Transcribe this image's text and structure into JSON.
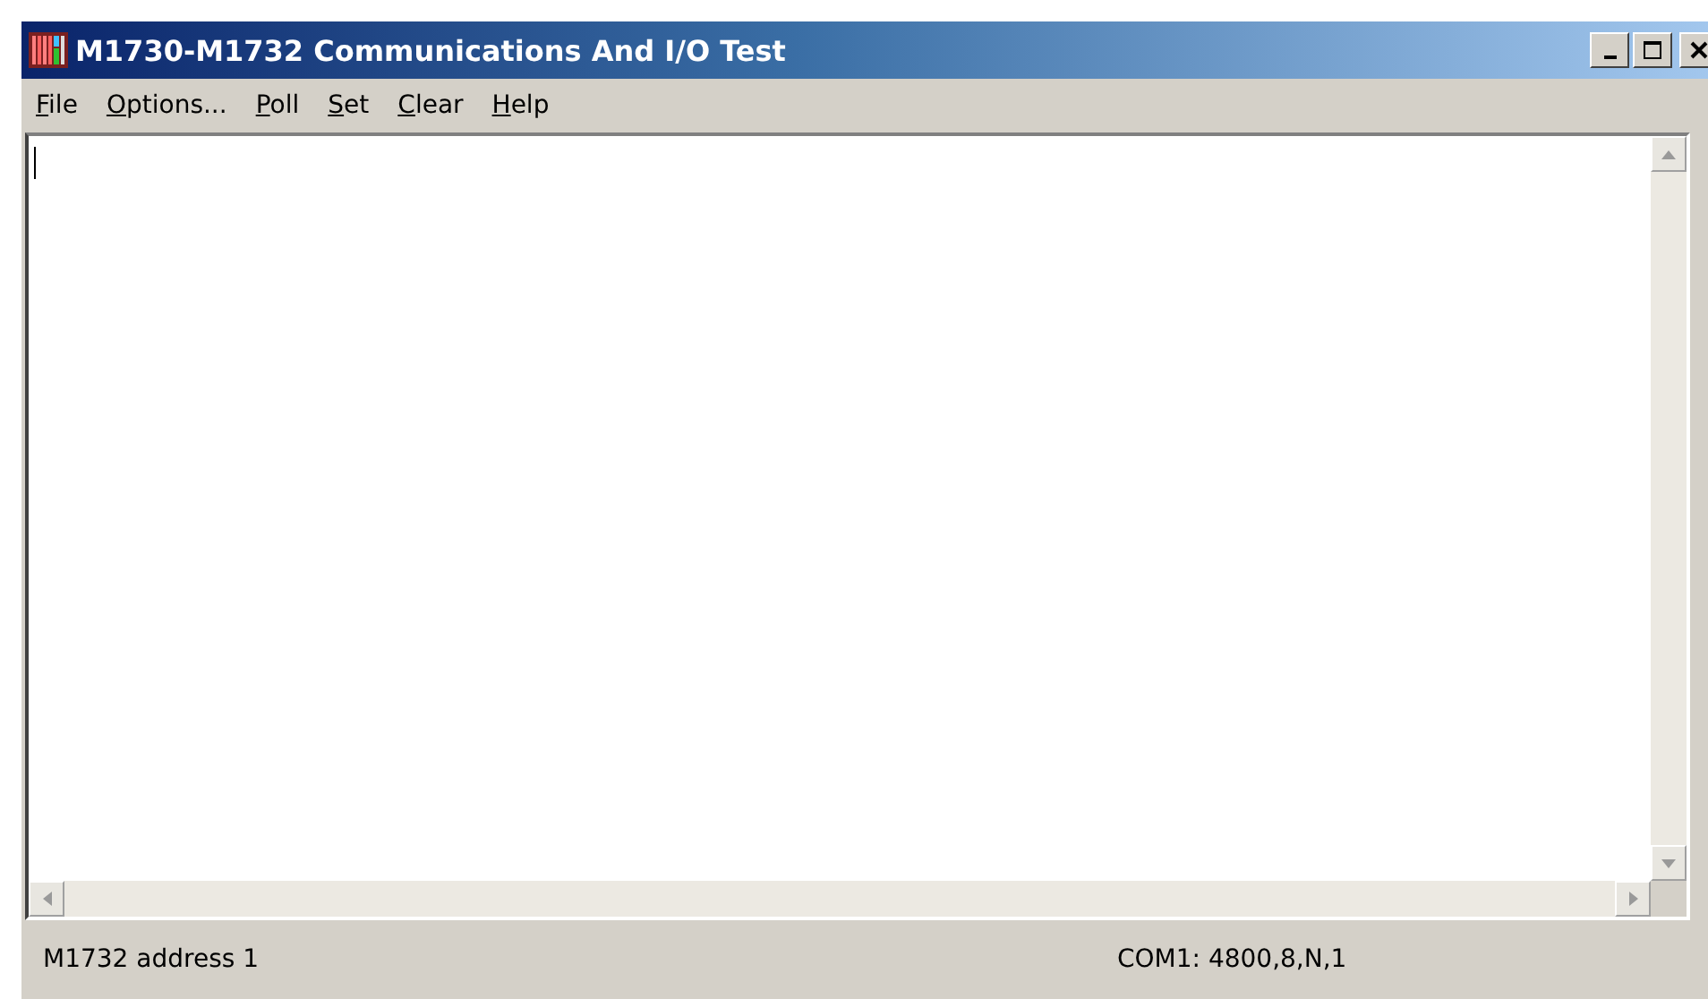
{
  "window": {
    "title": "M1730-M1732 Communications And I/O Test"
  },
  "menu": [
    {
      "label": "File",
      "underline_first": true
    },
    {
      "label": "Options...",
      "underline_first": true
    },
    {
      "label": "Poll",
      "underline_first": true
    },
    {
      "label": "Set",
      "underline_first": true
    },
    {
      "label": "Clear",
      "underline_first": true
    },
    {
      "label": "Help",
      "underline_first": true
    }
  ],
  "status_bar": [
    "M1732 address 1",
    "COM1: 4800,8,N,1"
  ]
}
